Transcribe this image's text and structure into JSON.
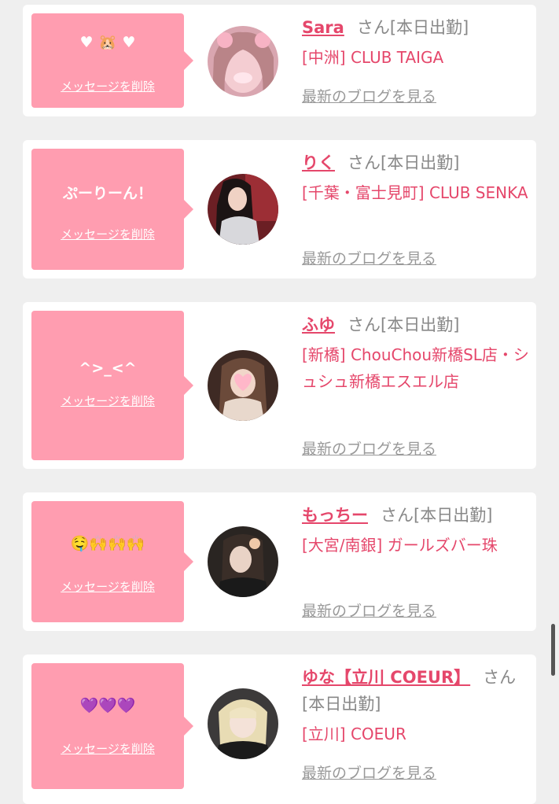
{
  "delete_label": "メッセージを削除",
  "blog_label": "最新のブログを見る",
  "cards": [
    {
      "message": "♥ 🐹 ♥",
      "name": "Sara",
      "suffix": "さん[本日出勤]",
      "shop": "[中洲] CLUB TAIGA"
    },
    {
      "message": "ぷーりーん！",
      "name": "りく",
      "suffix": "さん[本日出勤]",
      "shop": "[千葉・富士見町] CLUB SENKA"
    },
    {
      "message": "^>_<^",
      "name": "ふゆ",
      "suffix": "さん[本日出勤]",
      "shop": "[新橋] ChouChou新橋SL店・シュシュ新橋エスエル店"
    },
    {
      "message": "🤤🙌🙌🙌",
      "name": "もっちー",
      "suffix": "さん[本日出勤]",
      "shop": "[大宮/南銀] ガールズバー珠"
    },
    {
      "message": "💜💜💜",
      "name": "ゆな【立川 COEUR】",
      "suffix": "さん[本日出勤]",
      "shop": "[立川] COEUR"
    }
  ],
  "colors": {
    "accent": "#e5476b",
    "bubble": "#ff9db0",
    "muted": "#888888"
  }
}
